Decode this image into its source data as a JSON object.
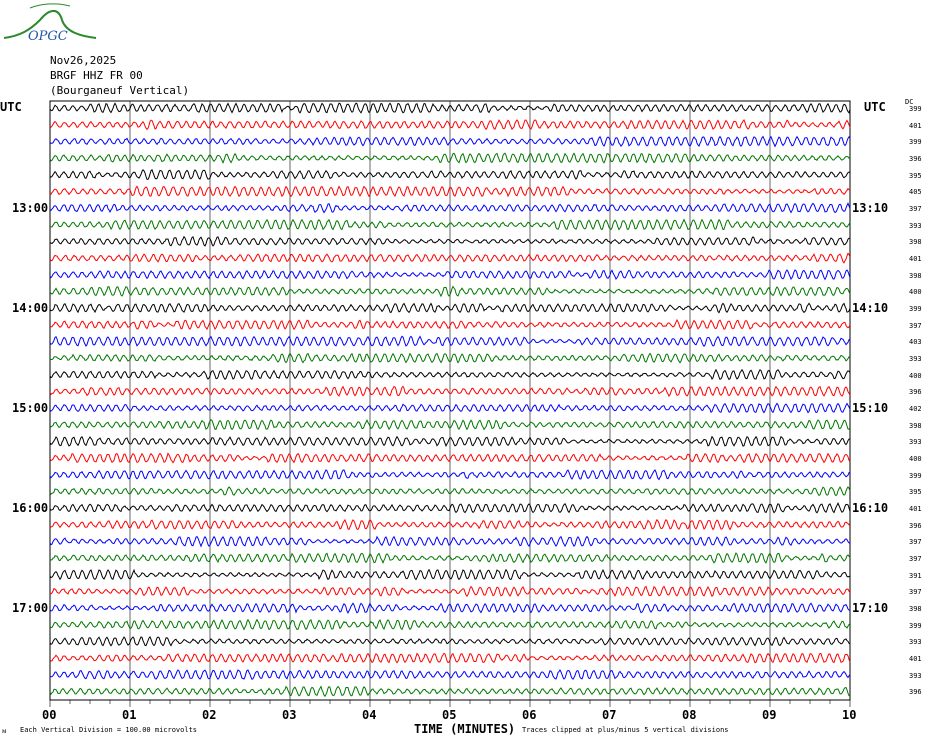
{
  "logo": {
    "text": "OPGC"
  },
  "header": {
    "date": "Nov26,2025",
    "station": "BRGF HHZ FR 00",
    "location": "(Bourganeuf Vertical)"
  },
  "left_tz": "UTC",
  "right_tz": "UTC",
  "dc_label": "DC",
  "chart_data": {
    "type": "line",
    "title": "BRGF HHZ FR 00 helicorder",
    "xlabel": "TIME (MINUTES)",
    "x_ticks": [
      "00",
      "01",
      "02",
      "03",
      "04",
      "05",
      "06",
      "07",
      "08",
      "09",
      "10"
    ],
    "xlim": [
      0,
      10
    ],
    "row_minutes": 10,
    "left_hour_labels": [
      {
        "row": 6,
        "label": "13:00"
      },
      {
        "row": 12,
        "label": "14:00"
      },
      {
        "row": 18,
        "label": "15:00"
      },
      {
        "row": 24,
        "label": "16:00"
      },
      {
        "row": 30,
        "label": "17:00"
      }
    ],
    "right_hour_labels": [
      {
        "row": 6,
        "label": "13:10"
      },
      {
        "row": 12,
        "label": "14:10"
      },
      {
        "row": 18,
        "label": "15:10"
      },
      {
        "row": 24,
        "label": "16:10"
      },
      {
        "row": 30,
        "label": "17:10"
      }
    ],
    "dc_offsets": [
      399,
      401,
      399,
      396,
      395,
      405,
      397,
      393,
      398,
      401,
      398,
      400,
      399,
      397,
      403,
      393,
      400,
      396,
      402,
      398,
      393,
      400,
      399,
      395,
      401,
      396,
      397,
      397,
      391,
      397,
      398,
      399,
      393,
      401,
      393,
      396
    ],
    "trace_colors": [
      "#000000",
      "#ff0000",
      "#0000ff",
      "#007700"
    ]
  },
  "footer": {
    "scale": "Each Vertical Division =  100.00 microvolts",
    "clip": "Traces clipped at plus/minus 5 vertical divisions"
  }
}
